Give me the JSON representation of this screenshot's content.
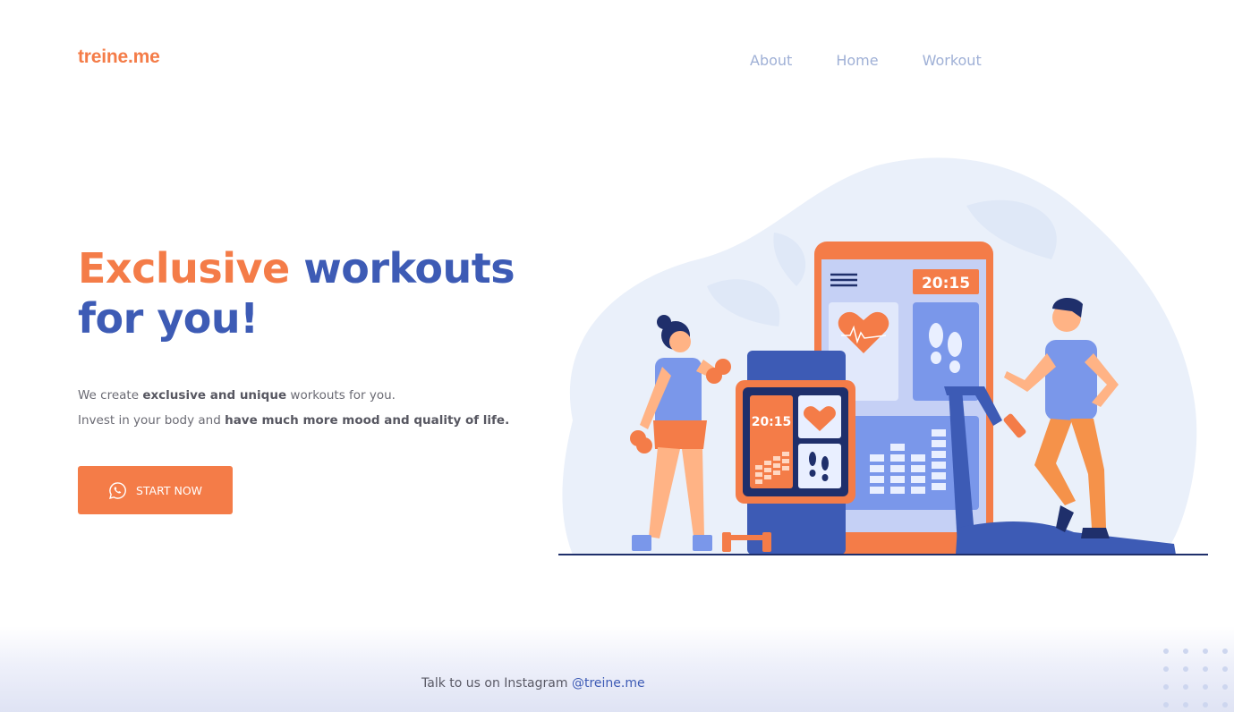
{
  "header": {
    "logo": "treine.me",
    "nav": [
      {
        "label": "About"
      },
      {
        "label": "Home"
      },
      {
        "label": "Workout"
      }
    ]
  },
  "hero": {
    "title_accent": "Exclusive",
    "title_rest": " workouts",
    "title_line2": "for you!",
    "line1_pre": "We create ",
    "line1_bold": "exclusive and unique",
    "line1_post": " workouts for you.",
    "line2_pre": "Invest in your body and ",
    "line2_bold": "have much more mood and quality of life.",
    "cta_label": "START NOW",
    "cta_icon": "whatsapp-icon"
  },
  "illustration": {
    "phone_time": "20:15",
    "watch_time": "20:15"
  },
  "footer": {
    "text": "Talk to us on Instagram ",
    "handle": "@treine.me"
  },
  "colors": {
    "accent": "#f47c48",
    "primary": "#3d5bb5",
    "nav": "#9fb0d6"
  }
}
